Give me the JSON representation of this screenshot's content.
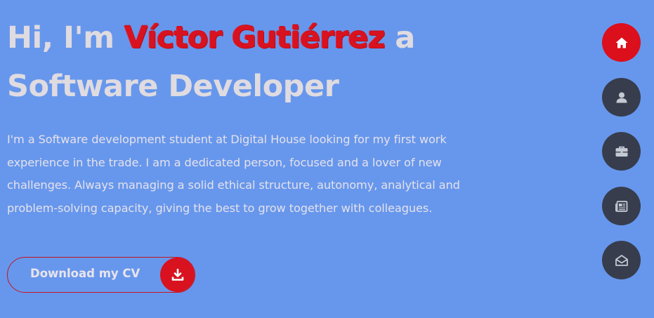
{
  "hero": {
    "intro": "Hi, I'm",
    "name": "Víctor Gutiérrez",
    "connector": "a",
    "role": "Software Developer",
    "bio": "I'm a Software development student at Digital House looking for my first work experience in the trade. I am a dedicated person, focused and a lover of new challenges. Always managing a solid ethical structure, autonomy, analytical and problem-solving capacity, giving the best to grow together with colleagues."
  },
  "cv_button": {
    "label": "Download my CV",
    "icon": "download-icon"
  },
  "side_nav": {
    "items": [
      {
        "icon": "home-icon",
        "active": true
      },
      {
        "icon": "user-icon",
        "active": false
      },
      {
        "icon": "briefcase-icon",
        "active": false
      },
      {
        "icon": "newspaper-icon",
        "active": false
      },
      {
        "icon": "envelope-open-icon",
        "active": false
      }
    ]
  },
  "colors": {
    "background": "#6797ec",
    "accent": "#d9121f",
    "nav_button": "#373d4d",
    "text": "#dfdbe0"
  }
}
